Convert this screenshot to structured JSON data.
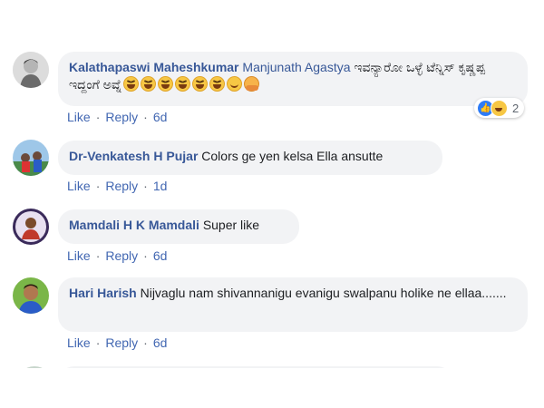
{
  "comments": [
    {
      "author": "Kalathapaswi Maheshkumar",
      "mention": "Manjunath Agastya",
      "text": "ಇವನ್ಯಾರೋ ಒಳ್ಳೆ ಟೆನ್ನಿಸ್ ಕೃಷ್ಣಪ್ಪ ಇದ್ದಂಗೆ ಅವ್ನೆ",
      "emojis": [
        "laughing-tears",
        "laughing-tears",
        "laughing-tears",
        "laughing-tears",
        "laughing-tears",
        "laughing-tears",
        "smiling-face",
        "hugging-face"
      ],
      "like": "Like",
      "reply": "Reply",
      "time": "6d",
      "reaction_count": "2"
    },
    {
      "author": "Dr-Venkatesh H Pujar",
      "text": "Colors ge yen kelsa Ella ansutte",
      "like": "Like",
      "reply": "Reply",
      "time": "1d"
    },
    {
      "author": "Mamdali H K Mamdali",
      "text": "Super like",
      "like": "Like",
      "reply": "Reply",
      "time": "6d"
    },
    {
      "author": "Hari Harish",
      "text": "Nijvaglu nam shivannanigu evanigu swalpanu holike ne ellaa.......",
      "like": "Like",
      "reply": "Reply",
      "time": "6d"
    }
  ],
  "separator": "·",
  "colors": {
    "link": "#385898",
    "action": "#4267b2",
    "bubble": "#f2f3f5"
  }
}
